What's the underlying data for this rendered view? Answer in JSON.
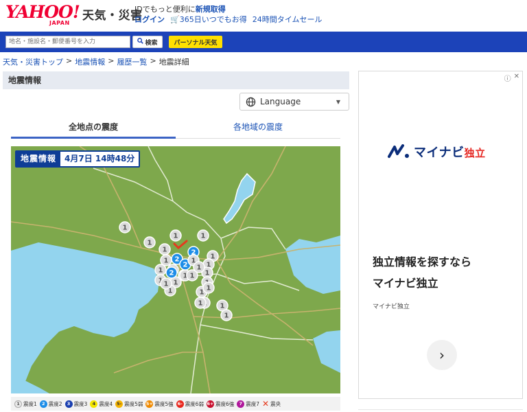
{
  "header": {
    "logo_main": "YAHOO!",
    "logo_sub": "JAPAN",
    "service_name": "天気・災害",
    "promo_prefix": "IDでもっと便利に",
    "promo_link": "新規取得",
    "login_label": "ログイン",
    "deal_label": "365日いつでもお得",
    "sale_label": "24時間タイムセール"
  },
  "search": {
    "placeholder": "地名・施設名・郵便番号を入力",
    "button_label": "検索",
    "personal_label": "パーソナル天気"
  },
  "breadcrumb": {
    "items": [
      "天気・災害トップ",
      "地震情報",
      "履歴一覧",
      "地震詳細"
    ],
    "separator": ">"
  },
  "section": {
    "title": "地震情報",
    "language_label": "Language"
  },
  "tabs": [
    {
      "label": "全地点の震度",
      "active": true
    },
    {
      "label": "各地域の震度",
      "active": false
    }
  ],
  "map": {
    "badge_title": "地震情報",
    "badge_time": "4月7日 14時48分",
    "markers": [
      {
        "label": "1",
        "type": "shindo1"
      },
      {
        "label": "1",
        "type": "shindo1"
      },
      {
        "label": "1",
        "type": "shindo1"
      },
      {
        "label": "1",
        "type": "shindo1"
      },
      {
        "label": "1",
        "type": "shindo1"
      },
      {
        "label": "1",
        "type": "shindo1"
      },
      {
        "label": "1",
        "type": "shindo1"
      },
      {
        "label": "1",
        "type": "shindo1"
      },
      {
        "label": "1",
        "type": "shindo1"
      },
      {
        "label": "1",
        "type": "shindo1"
      },
      {
        "label": "1",
        "type": "shindo1"
      },
      {
        "label": "1",
        "type": "shindo1"
      },
      {
        "label": "1",
        "type": "shindo1"
      },
      {
        "label": "1",
        "type": "shindo1"
      },
      {
        "label": "1",
        "type": "shindo1"
      },
      {
        "label": "1",
        "type": "shindo1"
      },
      {
        "label": "1",
        "type": "shindo1"
      },
      {
        "label": "1",
        "type": "shindo1"
      },
      {
        "label": "1",
        "type": "shindo1"
      },
      {
        "label": "1",
        "type": "shindo1"
      },
      {
        "label": "1",
        "type": "shindo1"
      },
      {
        "label": "1",
        "type": "shindo1"
      },
      {
        "label": "1",
        "type": "shindo1"
      },
      {
        "label": "1",
        "type": "shindo1"
      },
      {
        "label": "2",
        "type": "shindo2"
      },
      {
        "label": "2",
        "type": "shindo2"
      },
      {
        "label": "2",
        "type": "shindo2"
      },
      {
        "label": "2",
        "type": "shindo2"
      }
    ]
  },
  "legend": [
    {
      "label": "震度1",
      "symbol": "1",
      "color": "#e8e8e8",
      "text_color": "#555"
    },
    {
      "label": "震度2",
      "symbol": "2",
      "color": "#1e8ee8",
      "text_color": "#fff"
    },
    {
      "label": "震度3",
      "symbol": "3",
      "color": "#1a3fb0",
      "text_color": "#fff"
    },
    {
      "label": "震度4",
      "symbol": "4",
      "color": "#f3e600",
      "text_color": "#333"
    },
    {
      "label": "震度5弱",
      "symbol": "5-",
      "color": "#f7b500",
      "text_color": "#333"
    },
    {
      "label": "震度5強",
      "symbol": "5+",
      "color": "#f08a00",
      "text_color": "#fff"
    },
    {
      "label": "震度6弱",
      "symbol": "6-",
      "color": "#e8261c",
      "text_color": "#fff"
    },
    {
      "label": "震度6強",
      "symbol": "6+",
      "color": "#c8102e",
      "text_color": "#fff"
    },
    {
      "label": "震度7",
      "symbol": "7",
      "color": "#b0189c",
      "text_color": "#fff"
    },
    {
      "label": "震央",
      "symbol": "✕",
      "color": "#e53a1e",
      "text_color": "#e53a1e"
    }
  ],
  "ad": {
    "brand_main": "マイナビ",
    "brand_accent": "独立",
    "headline_line1": "独立情報を探すなら",
    "headline_line2": "マイナビ独立",
    "sponsor": "マイナビ独立",
    "next_glyph": "›"
  },
  "colors": {
    "header_bar": "#1c43b9",
    "link": "#1a52b5",
    "map_land": "#7ea84c",
    "map_water": "#93d4ee",
    "map_road": "#c7b36e",
    "shindo1": "#dcdcdc",
    "shindo2": "#1e8ee8"
  }
}
